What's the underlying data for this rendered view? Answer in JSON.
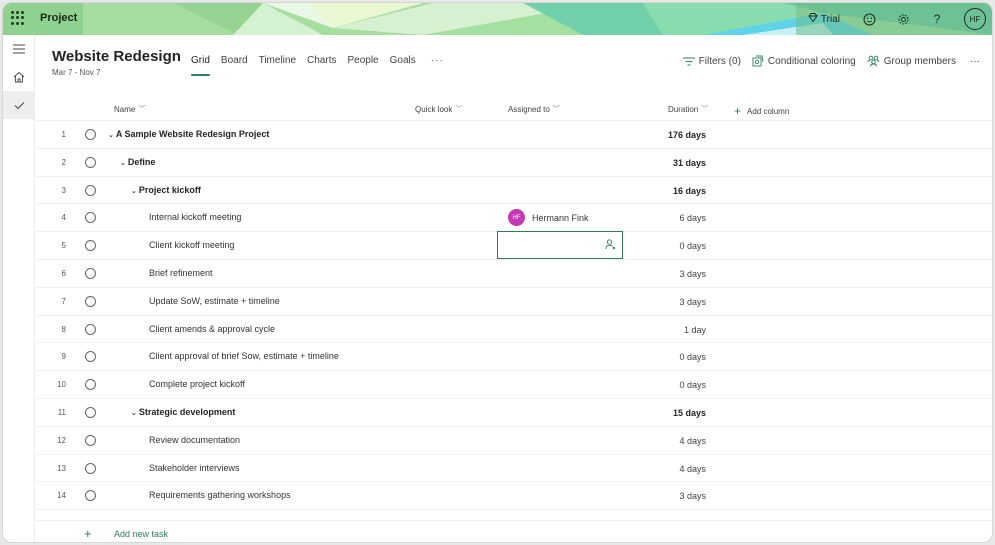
{
  "app": {
    "name": "Project",
    "trial_label": "Trial",
    "user_initials": "HF"
  },
  "rail": {
    "items": [
      "menu",
      "home",
      "tasks"
    ]
  },
  "project": {
    "title": "Website Redesign",
    "dates": "Mar 7 - Nov 7"
  },
  "tabs": [
    {
      "label": "Grid",
      "active": true
    },
    {
      "label": "Board"
    },
    {
      "label": "Timeline"
    },
    {
      "label": "Charts"
    },
    {
      "label": "People"
    },
    {
      "label": "Goals"
    }
  ],
  "tabs_more": "···",
  "actions": {
    "filters": "Filters (0)",
    "conditional_coloring": "Conditional coloring",
    "group_members": "Group members",
    "more": "···"
  },
  "columns": {
    "name": "Name",
    "quick_look": "Quick look",
    "assigned_to": "Assigned to",
    "duration": "Duration",
    "add_column": "Add column"
  },
  "rows": [
    {
      "num": "1",
      "name": "A Sample Website Redesign Project",
      "level": 0,
      "summary": true,
      "duration": "176 days"
    },
    {
      "num": "2",
      "name": "Define",
      "level": 1,
      "summary": true,
      "duration": "31 days"
    },
    {
      "num": "3",
      "name": "Project kickoff",
      "level": 2,
      "summary": true,
      "duration": "16 days"
    },
    {
      "num": "4",
      "name": "Internal kickoff meeting",
      "level": 3,
      "summary": false,
      "duration": "6 days",
      "assignee": {
        "initials": "HF",
        "name": "Hermann Fink",
        "color": "#c239b3"
      }
    },
    {
      "num": "5",
      "name": "Client kickoff meeting",
      "level": 3,
      "summary": false,
      "duration": "0 days",
      "editing_assignee": true
    },
    {
      "num": "6",
      "name": "Brief refinement",
      "level": 3,
      "summary": false,
      "duration": "3 days"
    },
    {
      "num": "7",
      "name": "Update SoW, estimate + timeline",
      "level": 3,
      "summary": false,
      "duration": "3 days"
    },
    {
      "num": "8",
      "name": "Client amends & approval cycle",
      "level": 3,
      "summary": false,
      "duration": "1 day"
    },
    {
      "num": "9",
      "name": "Client approval of brief Sow, estimate + timeline",
      "level": 3,
      "summary": false,
      "duration": "0 days"
    },
    {
      "num": "10",
      "name": "Complete project kickoff",
      "level": 3,
      "summary": false,
      "duration": "0 days"
    },
    {
      "num": "11",
      "name": "Strategic development",
      "level": 2,
      "summary": true,
      "duration": "15 days"
    },
    {
      "num": "12",
      "name": "Review documentation",
      "level": 3,
      "summary": false,
      "duration": "4 days"
    },
    {
      "num": "13",
      "name": "Stakeholder interviews",
      "level": 3,
      "summary": false,
      "duration": "4 days"
    },
    {
      "num": "14",
      "name": "Requirements gathering workshops",
      "level": 3,
      "summary": false,
      "duration": "3 days"
    }
  ],
  "add_task": "Add new task",
  "colors": {
    "accent": "#2e7d5b",
    "avatar": "#c239b3"
  }
}
